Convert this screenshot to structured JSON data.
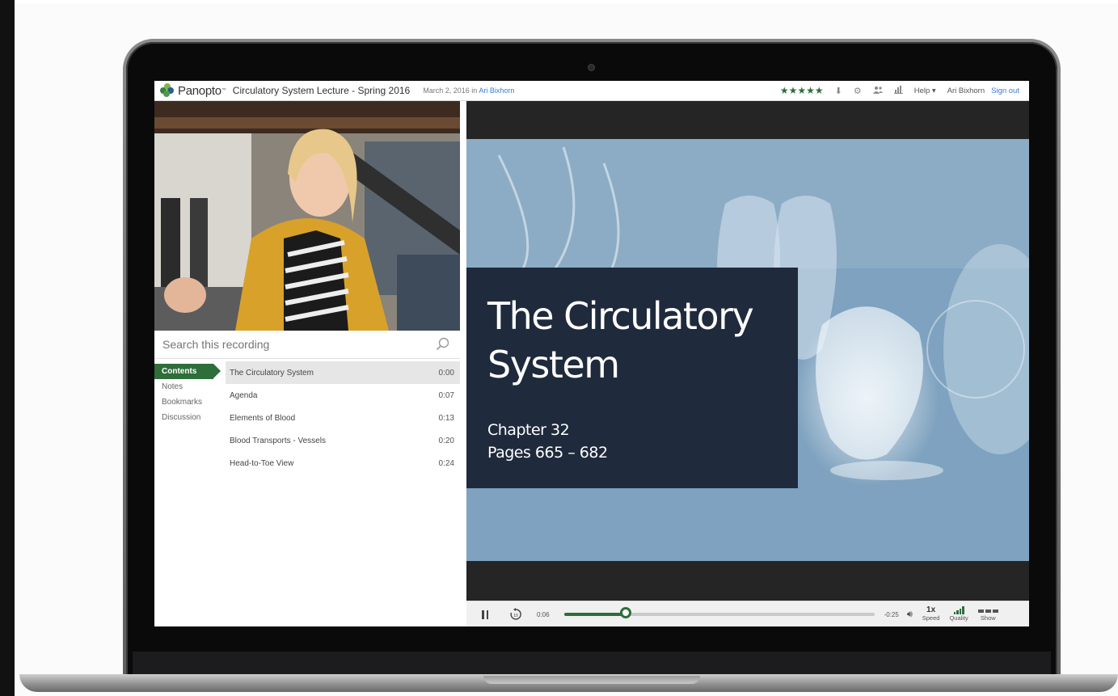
{
  "app": {
    "brand": "Panopto",
    "brand_mark": "™",
    "recording_title": "Circulatory System Lecture - Spring 2016",
    "recording_date": "March 2, 2016",
    "recording_in": "in",
    "recording_author": "Ari Bixhorn"
  },
  "topbar": {
    "rating": "★★★★★",
    "download_icon": "download-icon",
    "settings_icon": "gear-icon",
    "share_icon": "users-icon",
    "stats_icon": "stats-icon",
    "help_label": "Help ▾",
    "user_name": "Ari Bixhorn",
    "signout_label": "Sign out"
  },
  "search": {
    "placeholder": "Search this recording"
  },
  "sidenav": {
    "items": [
      {
        "label": "Contents",
        "active": true
      },
      {
        "label": "Notes"
      },
      {
        "label": "Bookmarks"
      },
      {
        "label": "Discussion"
      }
    ]
  },
  "contents": {
    "rows": [
      {
        "title": "The Circulatory System",
        "time": "0:00",
        "selected": true
      },
      {
        "title": "Agenda",
        "time": "0:07"
      },
      {
        "title": "Elements of Blood",
        "time": "0:13"
      },
      {
        "title": "Blood Transports - Vessels",
        "time": "0:20"
      },
      {
        "title": "Head-to-Toe View",
        "time": "0:24"
      }
    ]
  },
  "slide": {
    "title": "The Circulatory System",
    "subtitle_line1": "Chapter 32",
    "subtitle_line2": "Pages 665 – 682"
  },
  "controls": {
    "time_elapsed": "0:06",
    "time_remaining": "-0:25",
    "progress": 0.2,
    "speed_value": "1x",
    "speed_label": "Speed",
    "quality_label": "Quality",
    "show_label": "Show"
  },
  "colors": {
    "brand_green": "#2e6e3a",
    "link_blue": "#3a7bd5",
    "slide_card": "#1f2a3c",
    "slide_bg": "#7ea2bf"
  }
}
